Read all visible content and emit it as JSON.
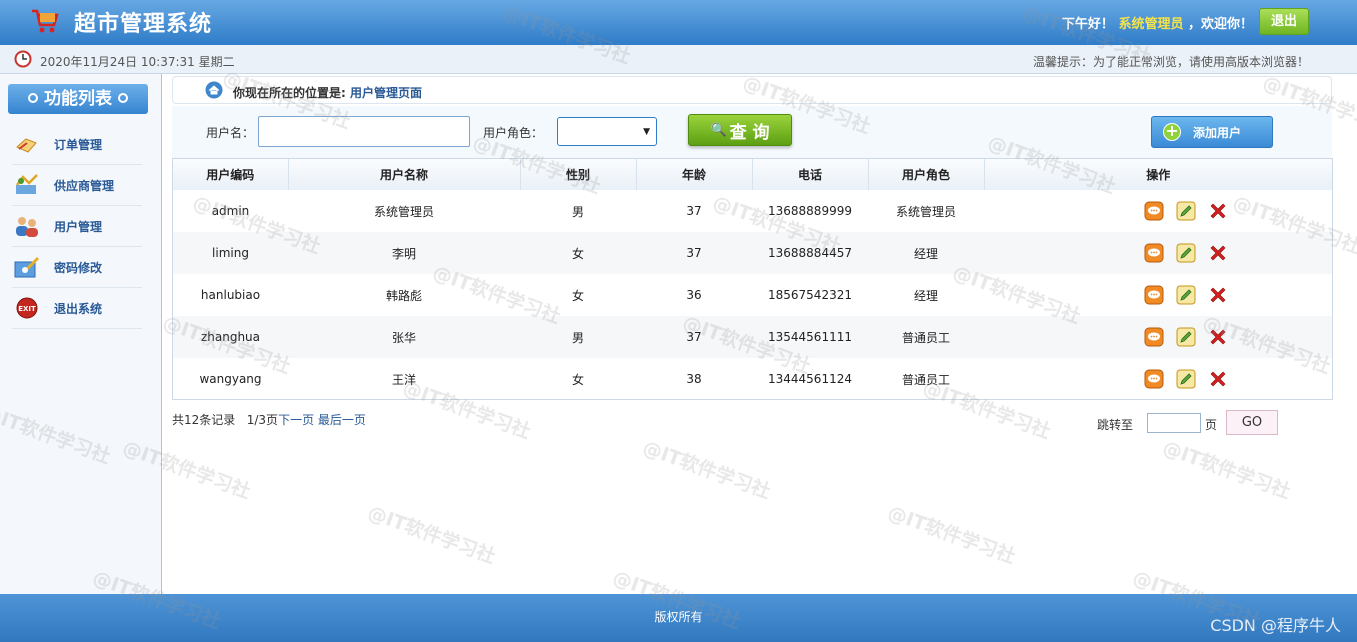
{
  "header": {
    "title": "超市管理系统",
    "greeting_prefix": "下午好！",
    "username": "系统管理员",
    "greeting_suffix": "，欢迎你！",
    "logout_label": "退出"
  },
  "subbar": {
    "datetime": "2020年11月24日 10:37:31 星期二",
    "tip": "温馨提示：为了能正常浏览，请使用高版本浏览器！"
  },
  "sidebar": {
    "title": "功能列表",
    "items": [
      {
        "label": "订单管理",
        "icon": "order-icon"
      },
      {
        "label": "供应商管理",
        "icon": "supplier-icon"
      },
      {
        "label": "用户管理",
        "icon": "users-icon"
      },
      {
        "label": "密码修改",
        "icon": "password-icon"
      },
      {
        "label": "退出系统",
        "icon": "exit-icon"
      }
    ]
  },
  "location": {
    "prefix": "你现在所在的位置是:",
    "current": "用户管理页面"
  },
  "search": {
    "username_label": "用户名：",
    "username_value": "",
    "role_label": "用户角色：",
    "role_value": "",
    "query_label": "查 询",
    "add_label": "添加用户"
  },
  "table": {
    "columns": [
      "用户编码",
      "用户名称",
      "性别",
      "年龄",
      "电话",
      "用户角色",
      "操作"
    ],
    "rows": [
      [
        "admin",
        "系统管理员",
        "男",
        "37",
        "13688889999",
        "系统管理员"
      ],
      [
        "liming",
        "李明",
        "女",
        "37",
        "13688884457",
        "经理"
      ],
      [
        "hanlubiao",
        "韩路彪",
        "女",
        "36",
        "18567542321",
        "经理"
      ],
      [
        "zhanghua",
        "张华",
        "男",
        "37",
        "13544561111",
        "普通员工"
      ],
      [
        "wangyang",
        "王洋",
        "女",
        "38",
        "13444561124",
        "普通员工"
      ]
    ]
  },
  "pager": {
    "total": "共12条记录",
    "page_info": "1/3页",
    "next": "下一页",
    "last": "最后一页",
    "jump_label": "跳转至",
    "page_unit": "页",
    "go_label": "GO"
  },
  "footer": {
    "copyright": "版权所有",
    "csdn": "CSDN @程序牛人"
  },
  "watermark": "@IT软件学习社",
  "colors": {
    "header_blue": "#2f7cc8",
    "accent_green": "#6fb523",
    "link_blue": "#2a5a96",
    "delete_red": "#d21f1f"
  }
}
